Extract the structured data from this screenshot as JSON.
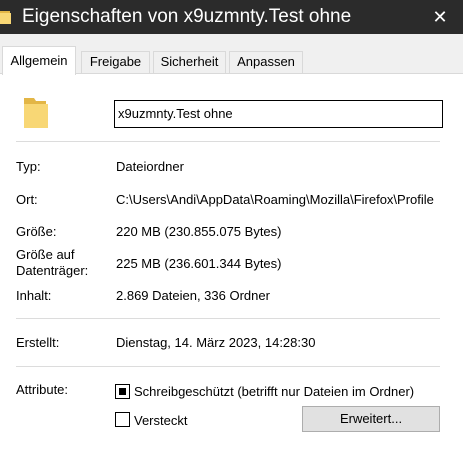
{
  "window": {
    "title": "Eigenschaften von x9uzmnty.Test ohne",
    "close_glyph": "✕"
  },
  "icons": {
    "title": "folder-icon",
    "folder": "folder-icon",
    "close": "close-icon"
  },
  "colors": {
    "titlebar": "#2b2b2b",
    "folder_light": "#f8d775",
    "folder_dark": "#e3b646"
  },
  "tabs": [
    {
      "label": "Allgemein",
      "active": true
    },
    {
      "label": "Freigabe",
      "active": false
    },
    {
      "label": "Sicherheit",
      "active": false
    },
    {
      "label": "Anpassen",
      "active": false
    }
  ],
  "general": {
    "name_value": "x9uzmnty.Test ohne",
    "type_label": "Typ:",
    "type_value": "Dateiordner",
    "location_label": "Ort:",
    "location_value": "C:\\Users\\Andi\\AppData\\Roaming\\Mozilla\\Firefox\\Profile",
    "size_label": "Größe:",
    "size_value": "220 MB (230.855.075 Bytes)",
    "disk_size_label_1": "Größe auf",
    "disk_size_label_2": "Datenträger:",
    "disk_size_value": "225 MB (236.601.344 Bytes)",
    "contents_label": "Inhalt:",
    "contents_value": "2.869 Dateien, 336 Ordner",
    "created_label": "Erstellt:",
    "created_value": "Dienstag, 14. März 2023, 14:28:30",
    "attributes_label": "Attribute:",
    "readonly_label": "Schreibgeschützt (betrifft nur Dateien im Ordner)",
    "readonly_state": "indeterminate",
    "hidden_label": "Versteckt",
    "hidden_checked": false,
    "advanced_button": "Erweitert..."
  }
}
